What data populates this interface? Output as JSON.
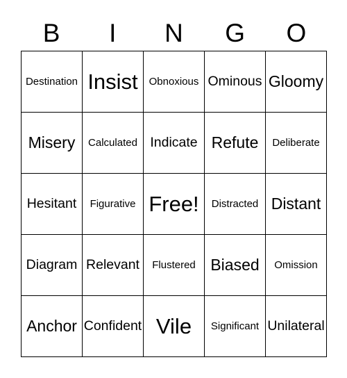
{
  "header": [
    "B",
    "I",
    "N",
    "G",
    "O"
  ],
  "cells": [
    [
      "Destination",
      "Insist",
      "Obnoxious",
      "Ominous",
      "Gloomy"
    ],
    [
      "Misery",
      "Calculated",
      "Indicate",
      "Refute",
      "Deliberate"
    ],
    [
      "Hesitant",
      "Figurative",
      "Free!",
      "Distracted",
      "Distant"
    ],
    [
      "Diagram",
      "Relevant",
      "Flustered",
      "Biased",
      "Omission"
    ],
    [
      "Anchor",
      "Confident",
      "Vile",
      "Significant",
      "Unilateral"
    ]
  ]
}
